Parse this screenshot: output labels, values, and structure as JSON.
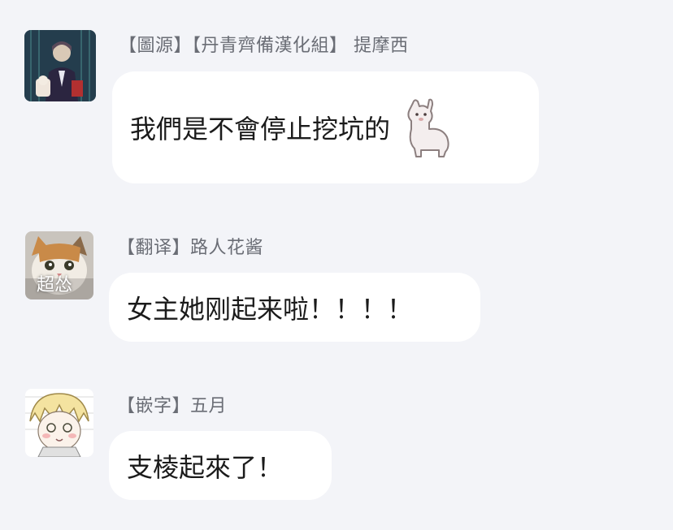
{
  "messages": [
    {
      "sender": "【圖源】【丹青齊備漢化組】 提摩西",
      "text": "我們是不會停止挖坑的",
      "sticker": "alpaca-sticker"
    },
    {
      "sender": "【翻译】路人花酱",
      "text": "女主她刚起来啦！！！！",
      "avatar_caption": "超怂"
    },
    {
      "sender": "【嵌字】五月",
      "text": "支棱起來了！"
    }
  ],
  "colors": {
    "background": "#f3f4f8",
    "bubble": "#ffffff",
    "sender_text": "#6a6d75",
    "message_text": "#1b1b1b"
  }
}
